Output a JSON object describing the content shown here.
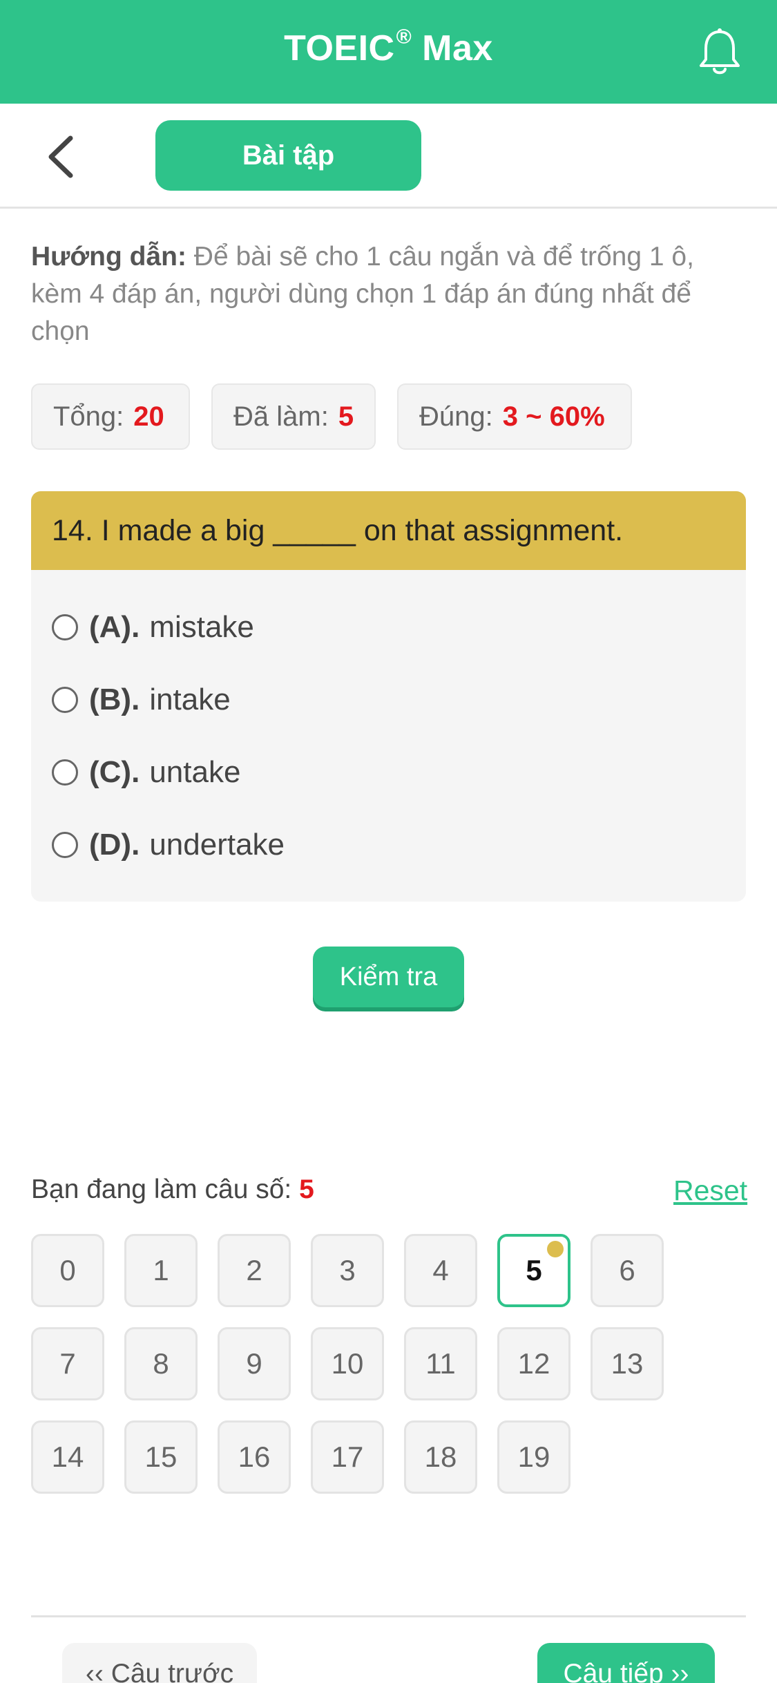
{
  "app_bar": {
    "title": "TOEIC",
    "title_mark": "®",
    "title_suffix": " Max"
  },
  "subbar": {
    "tab_label": "Bài tập"
  },
  "guide": {
    "label": "Hướng dẫn:",
    "text": " Để bài sẽ cho 1 câu ngắn và để trống 1 ô, kèm 4 đáp án, người dùng chọn 1 đáp án đúng nhất để chọn"
  },
  "stats": {
    "total_label": "Tổng:",
    "total_value": "20",
    "done_label": "Đã làm:",
    "done_value": "5",
    "correct_label": "Đúng:",
    "correct_value": "3 ~ 60%"
  },
  "question": {
    "text": "14. I made a big _____ on that assignment.",
    "options": [
      {
        "letter": "(A).",
        "text": "mistake"
      },
      {
        "letter": "(B).",
        "text": "intake"
      },
      {
        "letter": "(C).",
        "text": "untake"
      },
      {
        "letter": "(D).",
        "text": "undertake"
      }
    ]
  },
  "check_button": "Kiểm tra",
  "progress": {
    "current_label": "Bạn đang làm câu số:",
    "current_value": "5",
    "reset_label": "Reset",
    "numbers": [
      "0",
      "1",
      "2",
      "3",
      "4",
      "5",
      "6",
      "7",
      "8",
      "9",
      "10",
      "11",
      "12",
      "13",
      "14",
      "15",
      "16",
      "17",
      "18",
      "19"
    ],
    "active": "5"
  },
  "nav": {
    "prev_label": "‹‹ Câu trước",
    "next_label": "Câu tiếp ››"
  },
  "colors": {
    "brand": "#2ec38a",
    "question_header": "#dcbd4e",
    "highlight": "#e3191e"
  }
}
